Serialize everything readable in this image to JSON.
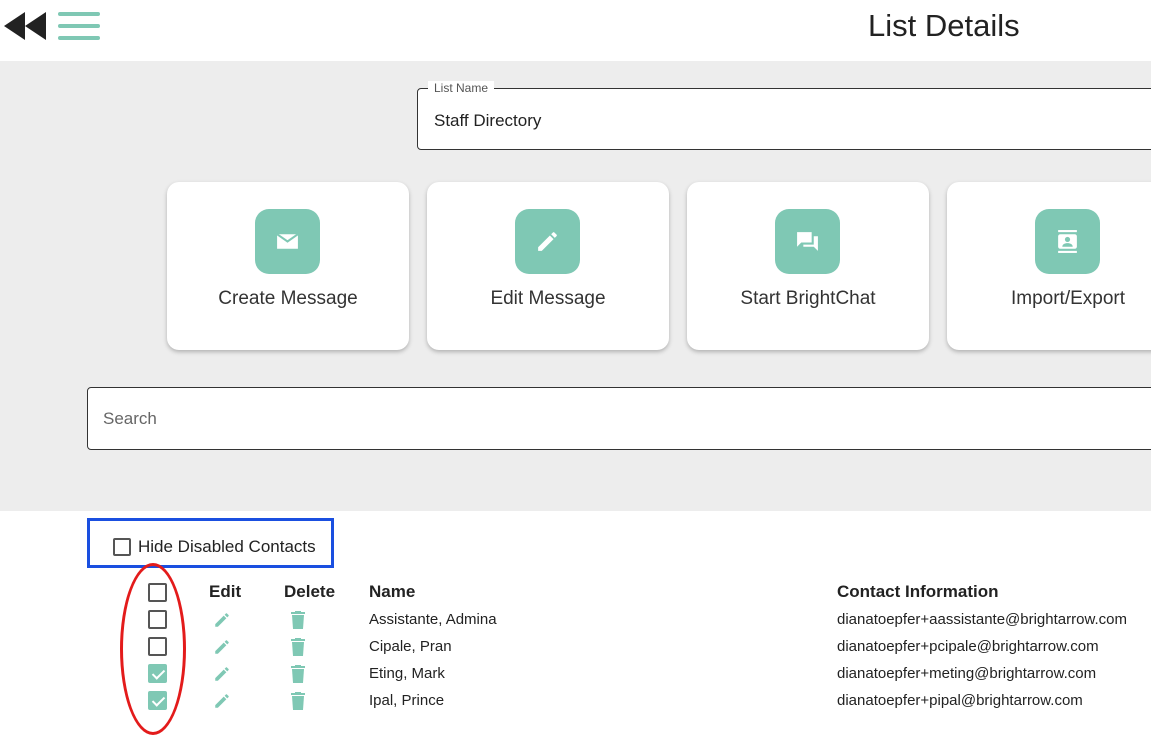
{
  "header": {
    "title": "List Details",
    "back_icon": "rewind-icon",
    "menu_icon": "hamburger-icon"
  },
  "list_name": {
    "label": "List Name",
    "value": "Staff Directory"
  },
  "actions": [
    {
      "label": "Create Message",
      "icon": "mail-icon"
    },
    {
      "label": "Edit Message",
      "icon": "pencil-icon"
    },
    {
      "label": "Start BrightChat",
      "icon": "chat-icon"
    },
    {
      "label": "Import/Export",
      "icon": "contact-card-icon"
    }
  ],
  "search": {
    "placeholder": "Search"
  },
  "filters": {
    "hide_disabled_label": "Hide Disabled Contacts",
    "hide_disabled_checked": false
  },
  "table": {
    "columns": [
      "Edit",
      "Delete",
      "Name",
      "Contact Information"
    ],
    "rows": [
      {
        "checked": false,
        "name": "Assistante, Admina",
        "contact": "dianatoepfer+aassistante@brightarrow.com"
      },
      {
        "checked": false,
        "name": "Cipale, Pran",
        "contact": "dianatoepfer+pcipale@brightarrow.com"
      },
      {
        "checked": true,
        "name": "Eting, Mark",
        "contact": "dianatoepfer+meting@brightarrow.com"
      },
      {
        "checked": true,
        "name": "Ipal, Prince",
        "contact": "dianatoepfer+pipal@brightarrow.com"
      }
    ]
  },
  "colors": {
    "accent": "#7fc8b4",
    "highlight_blue": "#1a4fe0",
    "highlight_red": "#e31b1b",
    "content_bg": "#ededed"
  }
}
